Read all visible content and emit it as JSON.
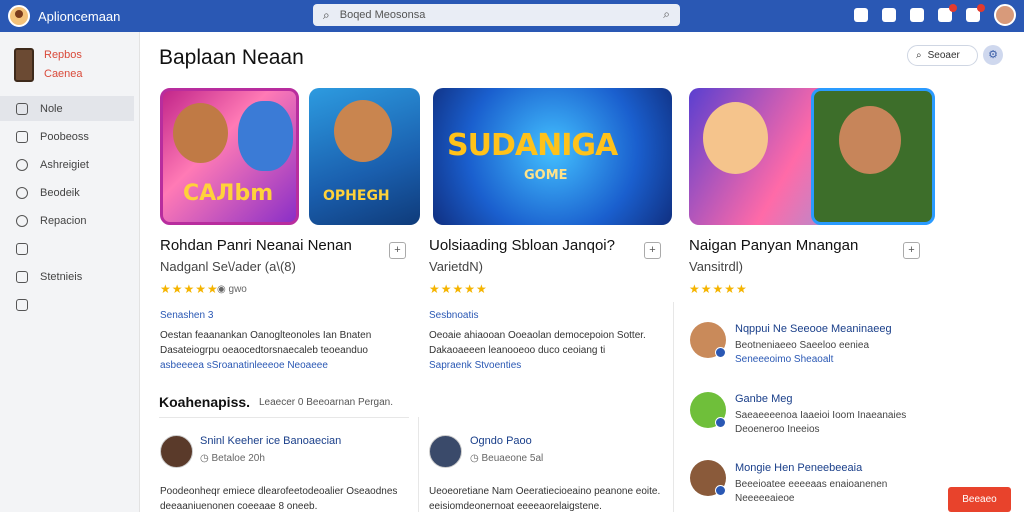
{
  "topbar": {
    "app_name": "Aplioncemaan",
    "search_placeholder": "Boqed Meosonsa",
    "icons": [
      "logo-icon",
      "search-icon",
      "camera-icon",
      "chat-icon",
      "bookmark-icon",
      "notification-icon",
      "grid-icon",
      "avatar"
    ]
  },
  "sidebar": {
    "header_line1": "Repbos",
    "header_line2": "Caenea",
    "items": [
      {
        "label": "Nole",
        "icon": "home-icon"
      },
      {
        "label": "Poobeoss",
        "icon": "inbox-icon"
      },
      {
        "label": "Ashreigiet",
        "icon": "chat-icon"
      },
      {
        "label": "Beodeik",
        "icon": "search-icon"
      },
      {
        "label": "Repacion",
        "icon": "clock-icon"
      },
      {
        "label": "",
        "icon": "edit-icon"
      },
      {
        "label": "Stetnieis",
        "icon": "chart-icon"
      },
      {
        "label": "",
        "icon": "check-icon"
      }
    ]
  },
  "main": {
    "title": "Baplaan Neaan",
    "sort_label": "Seoaer",
    "cards": [
      {
        "art_text": "CAЛbm",
        "art_text2": "OPHEGH",
        "title": "Rohdan Panri Neanai Nenan",
        "subtitle": "Nadganl Se\\/ader (a\\(8)",
        "meta": "gwo",
        "link": "Senashen 3",
        "desc": [
          "Oestan feaanankan Oanoglteonoles Ian Bnaten",
          "Dasateiogrpu oeaocedtorsnaecaleb teoeanduo",
          "asbeeeea sSroanatinleeeoe Neoaeee"
        ]
      },
      {
        "art_text": "SUDANIGA",
        "art_text2": "GOME",
        "title": "Uolsiaading Sbloan Janqoi?",
        "subtitle": "VarietdN)",
        "meta": "",
        "link": "Sesbnoatis",
        "desc": [
          "Oeoaie ahiaooan Ooeaolan democepoion Sotter.",
          "Dakaoaeeen leanooeoo duco ceoiang ti",
          "Sapraenk Stvoenties"
        ]
      },
      {
        "art_text": "",
        "art_text2": "",
        "title": "Naigan Panyan Mnangan",
        "subtitle": "Vansitrdl)",
        "meta": "",
        "link": "",
        "desc": []
      }
    ],
    "section_title": "Koahenapiss.",
    "section_sub": "Leaecer 0 Beeoarnan Pergan.",
    "reviews": [
      {
        "name": "Sninl Keeher ice Banoaecian",
        "meta": "Betaloe 20h",
        "text": [
          "Poodeonheqr emiece dlearofeetodeoalier Oseaodnes",
          "deeaaniuenonen coeeaae 8 oneeb."
        ]
      },
      {
        "name": "Ogndo Paoo",
        "meta": "Beuaeone 5al",
        "text": [
          "Ueoeoretiane Nam Oeeratiecioeaino peanone eoite.",
          "eeisiomdeonernoat eeeeaorelaigstene."
        ]
      }
    ],
    "side_list": [
      {
        "name": "Nqppui Ne Seeooe Meaninaeeg",
        "text": [
          "Beotneniaeeo Saeeloo eeniea",
          "Seneeeoimo Sheaoalt"
        ]
      },
      {
        "name": "Ganbe Meg",
        "text": [
          "Saeaeeeenoa Iaaeioi Ioom Inaeanaies",
          "Deoeneroo Ineeios"
        ]
      },
      {
        "name": "Mongie Hen Peneebeeaia",
        "text": [
          "Beeeioatee eeeeaas enaioanenen",
          "Neeeeeaieoe"
        ]
      }
    ],
    "action_button": "Beeaeo"
  }
}
